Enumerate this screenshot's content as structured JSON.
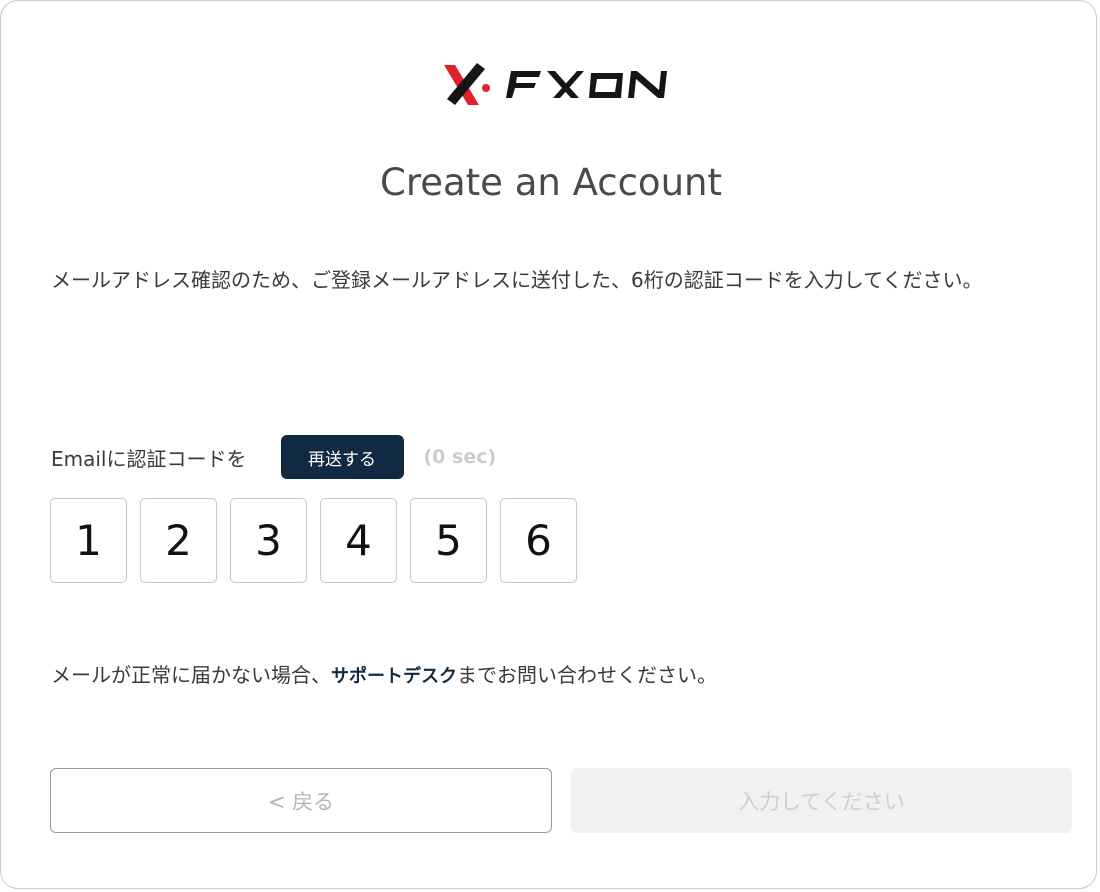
{
  "brand": {
    "name": "FXON",
    "colors": {
      "accent_red": "#e0202a",
      "dark": "#111111",
      "navy": "#0f2a42"
    }
  },
  "header": {
    "title": "Create an Account"
  },
  "instruction": "メールアドレス確認のため、ご登録メールアドレスに送付した、6桁の認証コードを入力してください。",
  "resend": {
    "label": "Emailに認証コードを",
    "button_label": "再送する",
    "timer": "(0 sec)"
  },
  "code": {
    "digits": [
      "1",
      "2",
      "3",
      "4",
      "5",
      "6"
    ]
  },
  "help": {
    "prefix": "メールが正常に届かない場合、",
    "link": "サポートデスク",
    "suffix": "までお問い合わせください。"
  },
  "actions": {
    "back_label": "< 戻る",
    "submit_label": "入力してください"
  }
}
